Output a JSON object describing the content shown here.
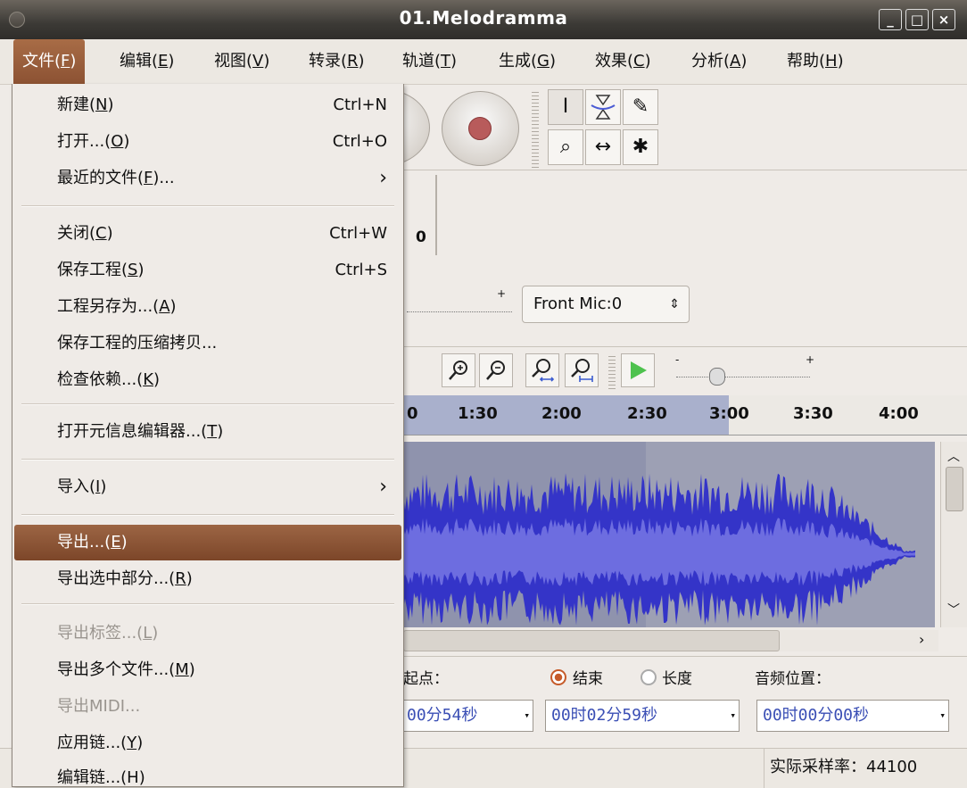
{
  "window": {
    "title": "01.Melodramma",
    "minimize": "–",
    "maximize": "□",
    "close": "×"
  },
  "menubar": [
    {
      "label": "文件(",
      "key": "F",
      "tail": ")"
    },
    {
      "label": "编辑(",
      "key": "E",
      "tail": ")"
    },
    {
      "label": "视图(",
      "key": "V",
      "tail": ")"
    },
    {
      "label": "转录(",
      "key": "R",
      "tail": ")"
    },
    {
      "label": "轨道(",
      "key": "T",
      "tail": ")"
    },
    {
      "label": "生成(",
      "key": "G",
      "tail": ")"
    },
    {
      "label": "效果(",
      "key": "C",
      "tail": ")"
    },
    {
      "label": "分析(",
      "key": "A",
      "tail": ")"
    },
    {
      "label": "帮助(",
      "key": "H",
      "tail": ")"
    }
  ],
  "file_menu": {
    "new": {
      "pre": "新建(",
      "key": "N",
      "post": ")",
      "accel": "Ctrl+N"
    },
    "open": {
      "pre": "打开...(",
      "key": "O",
      "post": ")",
      "accel": "Ctrl+O"
    },
    "recent": {
      "pre": "最近的文件(",
      "key": "F",
      "post": ")...",
      "arrow": "›"
    },
    "close": {
      "pre": "关闭(",
      "key": "C",
      "post": ")",
      "accel": "Ctrl+W"
    },
    "save": {
      "pre": "保存工程(",
      "key": "S",
      "post": ")",
      "accel": "Ctrl+S"
    },
    "save_as": {
      "pre": "工程另存为...(",
      "key": "A",
      "post": ")"
    },
    "save_compressed": {
      "pre": "保存工程的压缩拷贝..."
    },
    "check_deps": {
      "pre": "检查依赖...(",
      "key": "K",
      "post": ")"
    },
    "metadata": {
      "pre": "打开元信息编辑器...(",
      "key": "T",
      "post": ")"
    },
    "import": {
      "pre": "导入(",
      "key": "I",
      "post": ")",
      "arrow": "›"
    },
    "export": {
      "pre": "导出...(",
      "key": "E",
      "post": ")"
    },
    "export_sel": {
      "pre": "导出选中部分...(",
      "key": "R",
      "post": ")"
    },
    "export_labels": {
      "pre": "导出标签...(",
      "key": "L",
      "post": ")"
    },
    "export_multi": {
      "pre": "导出多个文件...(",
      "key": "M",
      "post": ")"
    },
    "export_midi": {
      "pre": "导出MIDI..."
    },
    "apply_chain": {
      "pre": "应用链...(",
      "key": "Y",
      "post": ")"
    },
    "edit_chain": {
      "pre": "编辑链...(H)"
    }
  },
  "toolbar": {
    "tools": [
      "I",
      "⧗",
      "✎",
      "⌕",
      "↔",
      "✱"
    ],
    "meter_value": "0",
    "input_device": "Front Mic:0"
  },
  "timeline": {
    "ticks": [
      "0",
      "1:30",
      "2:00",
      "2:30",
      "3:00",
      "3:30",
      "4:00"
    ]
  },
  "selection": {
    "start_label": "起点：",
    "end_label": "结束",
    "length_label": "长度",
    "audio_pos_label": "音频位置：",
    "start_value": "00分54秒",
    "end_value": "00时02分59秒",
    "audio_pos_value": "00时00分00秒"
  },
  "statusbar": {
    "rate_label": "实际采样率：",
    "rate_value": "44100"
  },
  "colors": {
    "accent": "#8c5233",
    "wave": "#3c3ccc",
    "wave_light": "#6666dd"
  }
}
